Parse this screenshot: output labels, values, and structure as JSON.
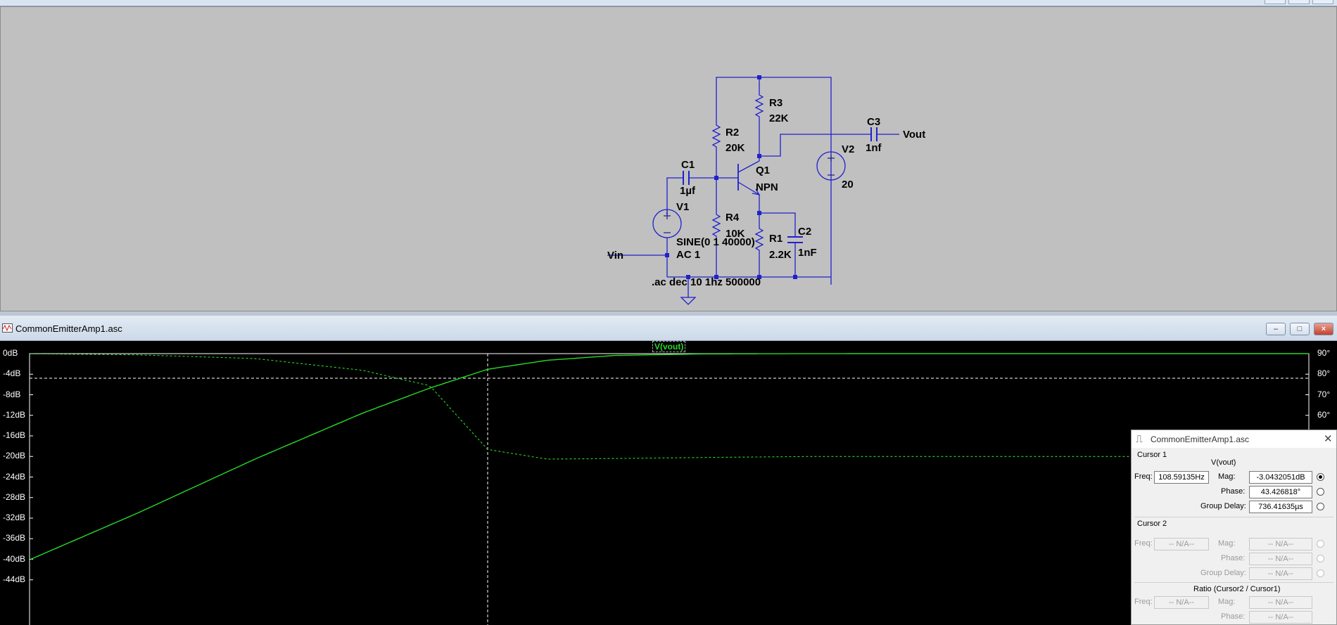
{
  "colors": {
    "wire": "#2020cc",
    "trace": "#27d927",
    "background": "#c0c0c0",
    "plot_bg": "#000000"
  },
  "schematic": {
    "labels": {
      "r3_name": "R3",
      "r3_value": "22K",
      "c3_name": "C3",
      "c3_value": "1nf",
      "vout": "Vout",
      "r2_name": "R2",
      "r2_value": "20K",
      "v2_name": "V2",
      "v2_value": "20",
      "c1_name": "C1",
      "c1_value": "1µf",
      "q1_name": "Q1",
      "q1_type": "NPN",
      "v1_name": "V1",
      "r4_name": "R4",
      "r4_value": "10K",
      "v1_sine": "SINE(0 1 40000)",
      "v1_ac": "AC 1",
      "r1_name": "R1",
      "r1_value": "2.2K",
      "c2_name": "C2",
      "c2_value": "1nF",
      "vin": "Vin",
      "directive": ".ac dec 10 1hz 500000"
    }
  },
  "plot_window": {
    "title": "CommonEmitterAmp1.asc",
    "controls": {
      "minimize": "‒",
      "maximize": "□",
      "close": "×"
    },
    "trace_label": "V(vout)",
    "y_left_ticks": [
      "0dB",
      "-4dB",
      "-8dB",
      "-12dB",
      "-16dB",
      "-20dB",
      "-24dB",
      "-28dB",
      "-32dB",
      "-36dB",
      "-40dB",
      "-44dB"
    ],
    "y_right_ticks": [
      "90°",
      "80°",
      "70°",
      "60°"
    ]
  },
  "chart_data": {
    "type": "line",
    "title": "V(vout)",
    "x_scale": "log",
    "x_range_hz": [
      1,
      500000
    ],
    "ylim_left_db": [
      -44,
      0
    ],
    "ylim_right_deg": [
      60,
      90
    ],
    "grid": false,
    "cursor": {
      "freq_hz": 108.59,
      "mag_db": -3.04,
      "phase_deg": 43.43
    },
    "series": [
      {
        "name": "V(vout)",
        "style": "solid",
        "x": [
          1,
          3,
          10,
          30,
          60,
          108.6,
          200,
          400,
          1000,
          3000,
          10000,
          100000,
          500000
        ],
        "y": [
          -40,
          -31,
          -20.5,
          -11.6,
          -6.7,
          -3.04,
          -1.3,
          -0.35,
          -0.06,
          -0.01,
          0,
          0,
          0
        ]
      },
      {
        "name": "V(vout)",
        "style": "dashed",
        "x": [
          1,
          3,
          10,
          30,
          60,
          108.6,
          200,
          400,
          1000,
          3000,
          10000,
          100000,
          500000
        ],
        "y": [
          89.9,
          89.4,
          87.6,
          81.9,
          74.4,
          43.4,
          38.7,
          39,
          39.5,
          40,
          40,
          40,
          40
        ]
      }
    ]
  },
  "cursor_dialog": {
    "title": "CommonEmitterAmp1.asc",
    "cursor1_label": "Cursor 1",
    "trace": "V(vout)",
    "freq_label": "Freq:",
    "freq_value": "108.59135Hz",
    "mag_label": "Mag:",
    "mag_value": "-3.0432051dB",
    "phase_label": "Phase:",
    "phase_value": "43.426818°",
    "gd_label": "Group Delay:",
    "gd_value": "736.41635µs",
    "cursor2_label": "Cursor 2",
    "c2_freq_value": "-- N/A--",
    "c2_mag_value": "-- N/A--",
    "c2_phase_value": "-- N/A--",
    "c2_gd_value": "-- N/A--",
    "ratio_label": "Ratio (Cursor2 / Cursor1)",
    "r_freq_value": "-- N/A--",
    "r_mag_value": "-- N/A--",
    "r_phase_value": "-- N/A--"
  }
}
